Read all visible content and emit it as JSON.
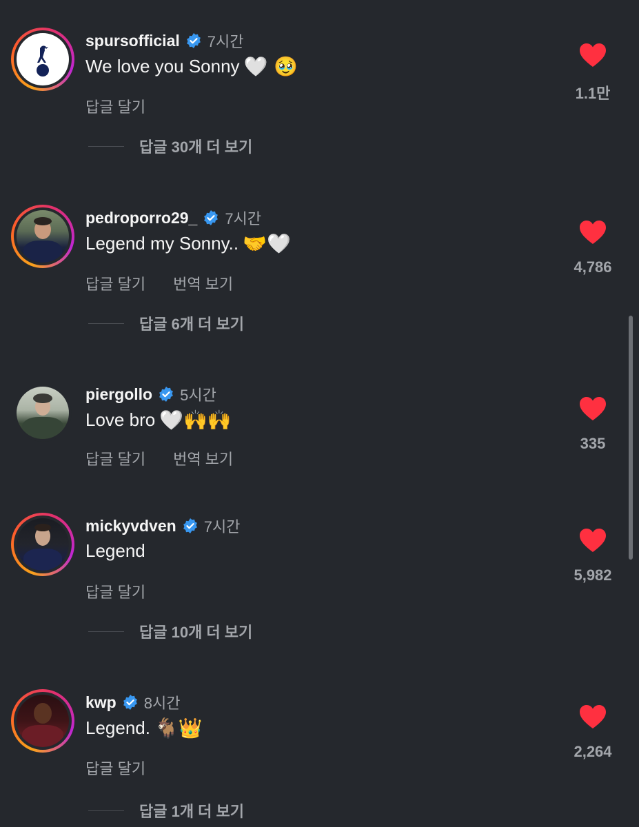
{
  "comments": [
    {
      "username": "spursofficial",
      "time": "7시간",
      "text": "We love you Sonny",
      "emojis": "🤍 🥹",
      "reply_label": "답글 달기",
      "translate_label": "",
      "likes": "1.1만",
      "more_replies": "답글 30개 더 보기"
    },
    {
      "username": "pedroporro29_",
      "time": "7시간",
      "text": "Legend my Sonny..",
      "emojis": "🤝🤍",
      "reply_label": "답글 달기",
      "translate_label": "번역 보기",
      "likes": "4,786",
      "more_replies": "답글 6개 더 보기"
    },
    {
      "username": "piergollo",
      "time": "5시간",
      "text": "Love bro",
      "emojis": "🤍🙌🙌",
      "reply_label": "답글 달기",
      "translate_label": "번역 보기",
      "likes": "335",
      "more_replies": ""
    },
    {
      "username": "mickyvdven",
      "time": "7시간",
      "text": "Legend",
      "emojis": "",
      "reply_label": "답글 달기",
      "translate_label": "",
      "likes": "5,982",
      "more_replies": "답글 10개 더 보기"
    },
    {
      "username": "kwp",
      "time": "8시간",
      "text": "Legend.",
      "emojis": "🐐👑",
      "reply_label": "답글 달기",
      "translate_label": "",
      "likes": "2,264",
      "more_replies": "답글 1개 더 보기"
    }
  ],
  "colors": {
    "background": "#25282d",
    "heart": "#ff3040",
    "verified": "#3897f0",
    "secondary_text": "#a3a6ab"
  },
  "icons": {
    "verified": "verified-badge-icon",
    "like": "heart-filled-icon"
  }
}
